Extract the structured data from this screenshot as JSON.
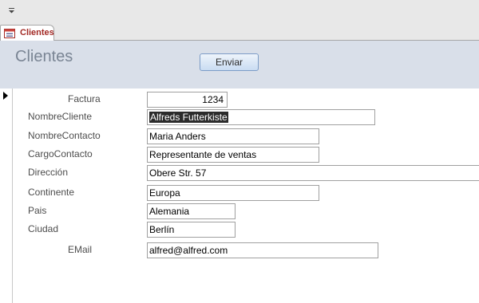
{
  "tab": {
    "label": "Clientes"
  },
  "header": {
    "title": "Clientes",
    "button_label": "Enviar"
  },
  "fields": {
    "factura": {
      "label": "Factura",
      "value": "1234"
    },
    "nombre_cliente": {
      "label": "NombreCliente",
      "value": "Alfreds Futterkiste"
    },
    "nombre_contacto": {
      "label": "NombreContacto",
      "value": "Maria Anders"
    },
    "cargo_contacto": {
      "label": "CargoContacto",
      "value": "Representante de ventas"
    },
    "direccion": {
      "label": "Dirección",
      "value": "Obere Str. 57"
    },
    "continente": {
      "label": "Continente",
      "value": "Europa"
    },
    "pais": {
      "label": "Pais",
      "value": "Alemania"
    },
    "ciudad": {
      "label": "Ciudad",
      "value": "Berlín"
    },
    "email": {
      "label": "EMail",
      "value": "alfred@alfred.com"
    }
  }
}
